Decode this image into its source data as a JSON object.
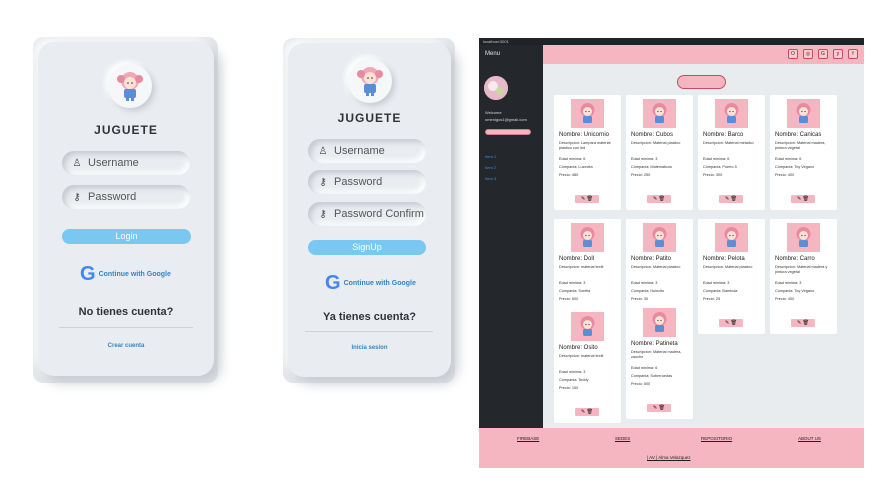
{
  "login_card": {
    "brand": "JUGUETE",
    "username_placeholder": "Username",
    "password_placeholder": "Password",
    "login_button": "Login",
    "google_button": "Continue with Google",
    "question": "No tienes cuenta?",
    "link": "Crear cuenta"
  },
  "signup_card": {
    "brand": "JUGUETE",
    "username_placeholder": "Username",
    "password_placeholder": "Password",
    "confirm_placeholder": "Password Confirm",
    "signup_button": "SignUp",
    "google_button": "Continue with Google",
    "question": "Ya tienes cuenta?",
    "link": "Inicia sesion"
  },
  "browser": {
    "url": "localhost:3001",
    "sidebar": {
      "menu": "Menu",
      "welcome": "Welcome",
      "email": "omenigos1@gmail.com",
      "logout_button": "",
      "nav": [
        "Item 1",
        "Item 2",
        "Item 3"
      ]
    },
    "social": [
      "O",
      "◎",
      "G",
      "y",
      "f"
    ],
    "add_button": "",
    "toys": [
      {
        "name": "Nombre: Unicornio",
        "desc": "Descripcion: Lampara material plastico con led",
        "edad": "Edad minima: 6",
        "compania": "Compania: Luzecita",
        "precio": "Precio: 480"
      },
      {
        "name": "Nombre: Cubos",
        "desc": "Descripcion: Material plastico",
        "edad": "Edad minima: 3",
        "compania": "Compania: Matematicos",
        "precio": "Precio: 250"
      },
      {
        "name": "Nombre: Barco",
        "desc": "Descripcion: Material metalico",
        "edad": "Edad minima: 6",
        "compania": "Compania: Puerto 5",
        "precio": "Precio: 300"
      },
      {
        "name": "Nombre: Canicas",
        "desc": "Descripcion: Material madera, pintura vegetal",
        "edad": "Edad minima: 6",
        "compania": "Compania: Toy Vegano",
        "precio": "Precio: 400"
      },
      {
        "name": "Nombre: Doll",
        "desc": "Descripcion: material textil",
        "edad": "Edad minima: 3",
        "compania": "Compania: Sorella",
        "precio": "Precio: 500"
      },
      {
        "name": "Nombre: Patito",
        "desc": "Descripcion: Material plastico",
        "edad": "Edad minima: 3",
        "compania": "Compania: Hulecito",
        "precio": "Precio: 30"
      },
      {
        "name": "Nombre: Pelota",
        "desc": "Descripcion: Material plastico",
        "edad": "Edad minima: 3",
        "compania": "Compania: Bambola",
        "precio": "Precio: 25"
      },
      {
        "name": "Nombre: Carro",
        "desc": "Descripcion: Material madera y pintura vegetal",
        "edad": "Edad minima: 3",
        "compania": "Compania: Toy Vegano",
        "precio": "Precio: 400"
      },
      {
        "name": "Nombre: Osito",
        "desc": "Descripcion: material textil",
        "edad": "Edad minima: 3",
        "compania": "Compania: Teddy",
        "precio": "Precio: 150"
      },
      {
        "name": "Nombre: Patineta",
        "desc": "Descripcion: Material madera, caucho",
        "edad": "Edad minima: 6",
        "compania": "Compania: Sobreruedas",
        "precio": "Precio: 500"
      }
    ],
    "actions": "✎ 🗑",
    "footer": {
      "links": [
        "FIREBASE",
        "SEDES",
        "REPOSITORIO",
        "ABOUT US"
      ],
      "credit": "| AV | Alma Velazquez"
    }
  },
  "colors": {
    "pink": "#f5b6c2",
    "blue": "#78c8f2",
    "dark": "#24282c",
    "neumorph": "#e9ecf0"
  }
}
